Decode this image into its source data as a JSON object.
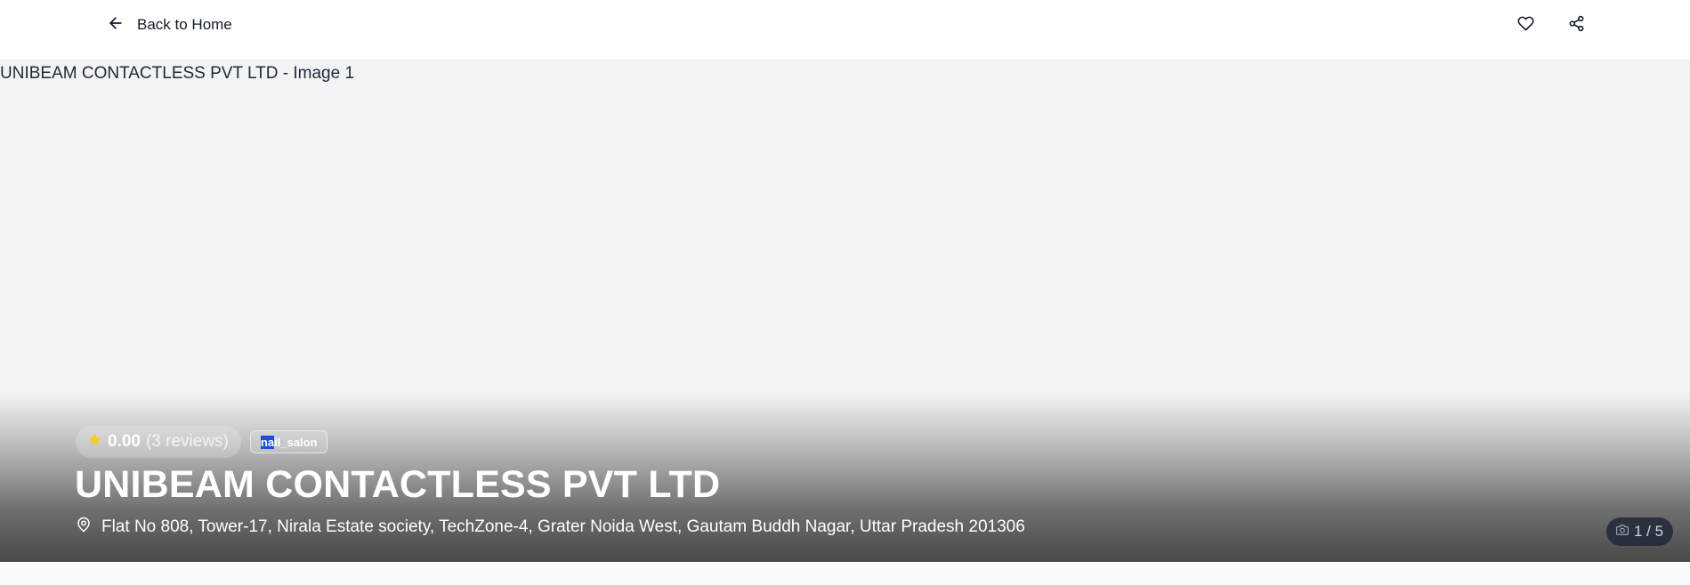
{
  "header": {
    "back_label": "Back to Home",
    "icons": {
      "back": "arrow-left-icon",
      "favorite": "heart-icon",
      "share": "share-icon"
    }
  },
  "hero": {
    "image_alt": "UNIBEAM CONTACTLESS PVT LTD - Image 1",
    "rating": {
      "value": "0.00",
      "reviews": "(3 reviews)",
      "icon": "star-icon",
      "star_color": "#facc15"
    },
    "category": {
      "selected_part": "na",
      "rest": "il_salon"
    },
    "title": "UNIBEAM CONTACTLESS PVT LTD",
    "address": {
      "icon": "map-pin-icon",
      "text": "Flat No 808, Tower-17, Nirala Estate society, TechZone-4, Grater Noida West, Gautam Buddh Nagar, Uttar Pradesh 201306"
    },
    "image_counter": {
      "icon": "camera-icon",
      "text": "1 / 5"
    }
  },
  "colors": {
    "hero_bg": "#f2f3f5",
    "page_bg": "#fafafa",
    "topbar_bg": "#ffffff"
  }
}
